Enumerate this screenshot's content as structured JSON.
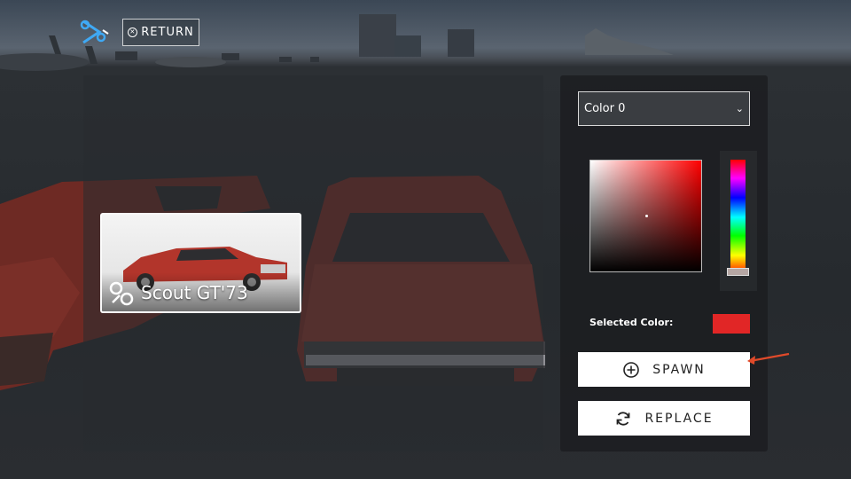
{
  "header": {
    "return_label": "RETURN"
  },
  "car_card": {
    "name": "Scout GT'73"
  },
  "color_panel": {
    "select_value": "Color 0",
    "selected_label": "Selected Color:",
    "selected_color": "#e12626"
  },
  "actions": {
    "spawn_label": "SPAWN",
    "replace_label": "REPLACE"
  },
  "icons": [
    "logo-icon",
    "return-icon",
    "car-icon",
    "chevron-down-icon",
    "plus-circle-icon",
    "refresh-icon",
    "arrow-indicator-icon"
  ],
  "colors": {
    "accent": "#e12626",
    "panel": "#1c1e21",
    "button": "#ffffff"
  }
}
